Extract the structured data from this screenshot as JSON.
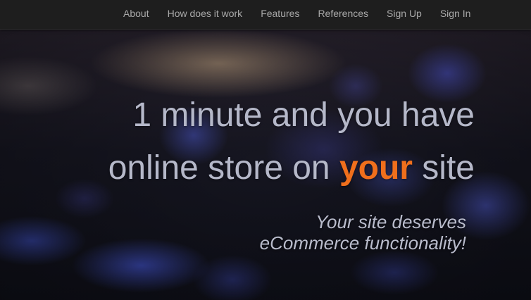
{
  "nav": {
    "items": [
      {
        "label": "About"
      },
      {
        "label": "How does it work"
      },
      {
        "label": "Features"
      },
      {
        "label": "References"
      },
      {
        "label": "Sign Up"
      },
      {
        "label": "Sign In"
      }
    ]
  },
  "hero": {
    "headline_line1": "1 minute and you have",
    "headline_line2_before": "online store on ",
    "headline_line2_accent": "your",
    "headline_line2_after": " site",
    "tagline_line1": "Your site deserves",
    "tagline_line2": "eCommerce functionality!"
  },
  "colors": {
    "navbar_bg": "#1e1e1e",
    "nav_text": "#a9a9a9",
    "headline_text": "#b5b8c9",
    "accent": "#f06f1c"
  }
}
